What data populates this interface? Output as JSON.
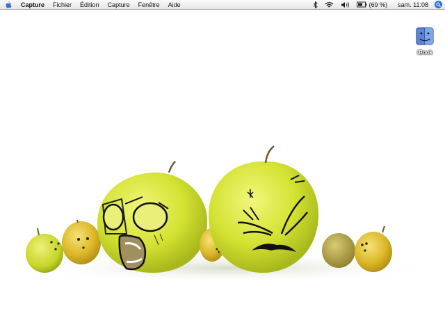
{
  "menubar": {
    "apple_icon": "apple-icon",
    "app_name": "Capture",
    "menus": [
      "Fichier",
      "Édition",
      "Capture",
      "Fenêtre",
      "Aide"
    ],
    "status": {
      "bluetooth_icon": "bluetooth-icon",
      "wifi_icon": "wifi-icon",
      "volume_icon": "volume-icon",
      "battery_icon": "battery-icon",
      "battery_text": "(69 %)",
      "clock": "sam. 11:08",
      "spotlight_icon": "spotlight-icon"
    }
  },
  "desktop": {
    "disk_label": "iBook",
    "disk_icon": "finder-disk-icon",
    "wallpaper": "angry-apples"
  },
  "colors": {
    "apple": "#d8e43c",
    "fruit": "#e0c020",
    "menubar": "#ececec"
  }
}
